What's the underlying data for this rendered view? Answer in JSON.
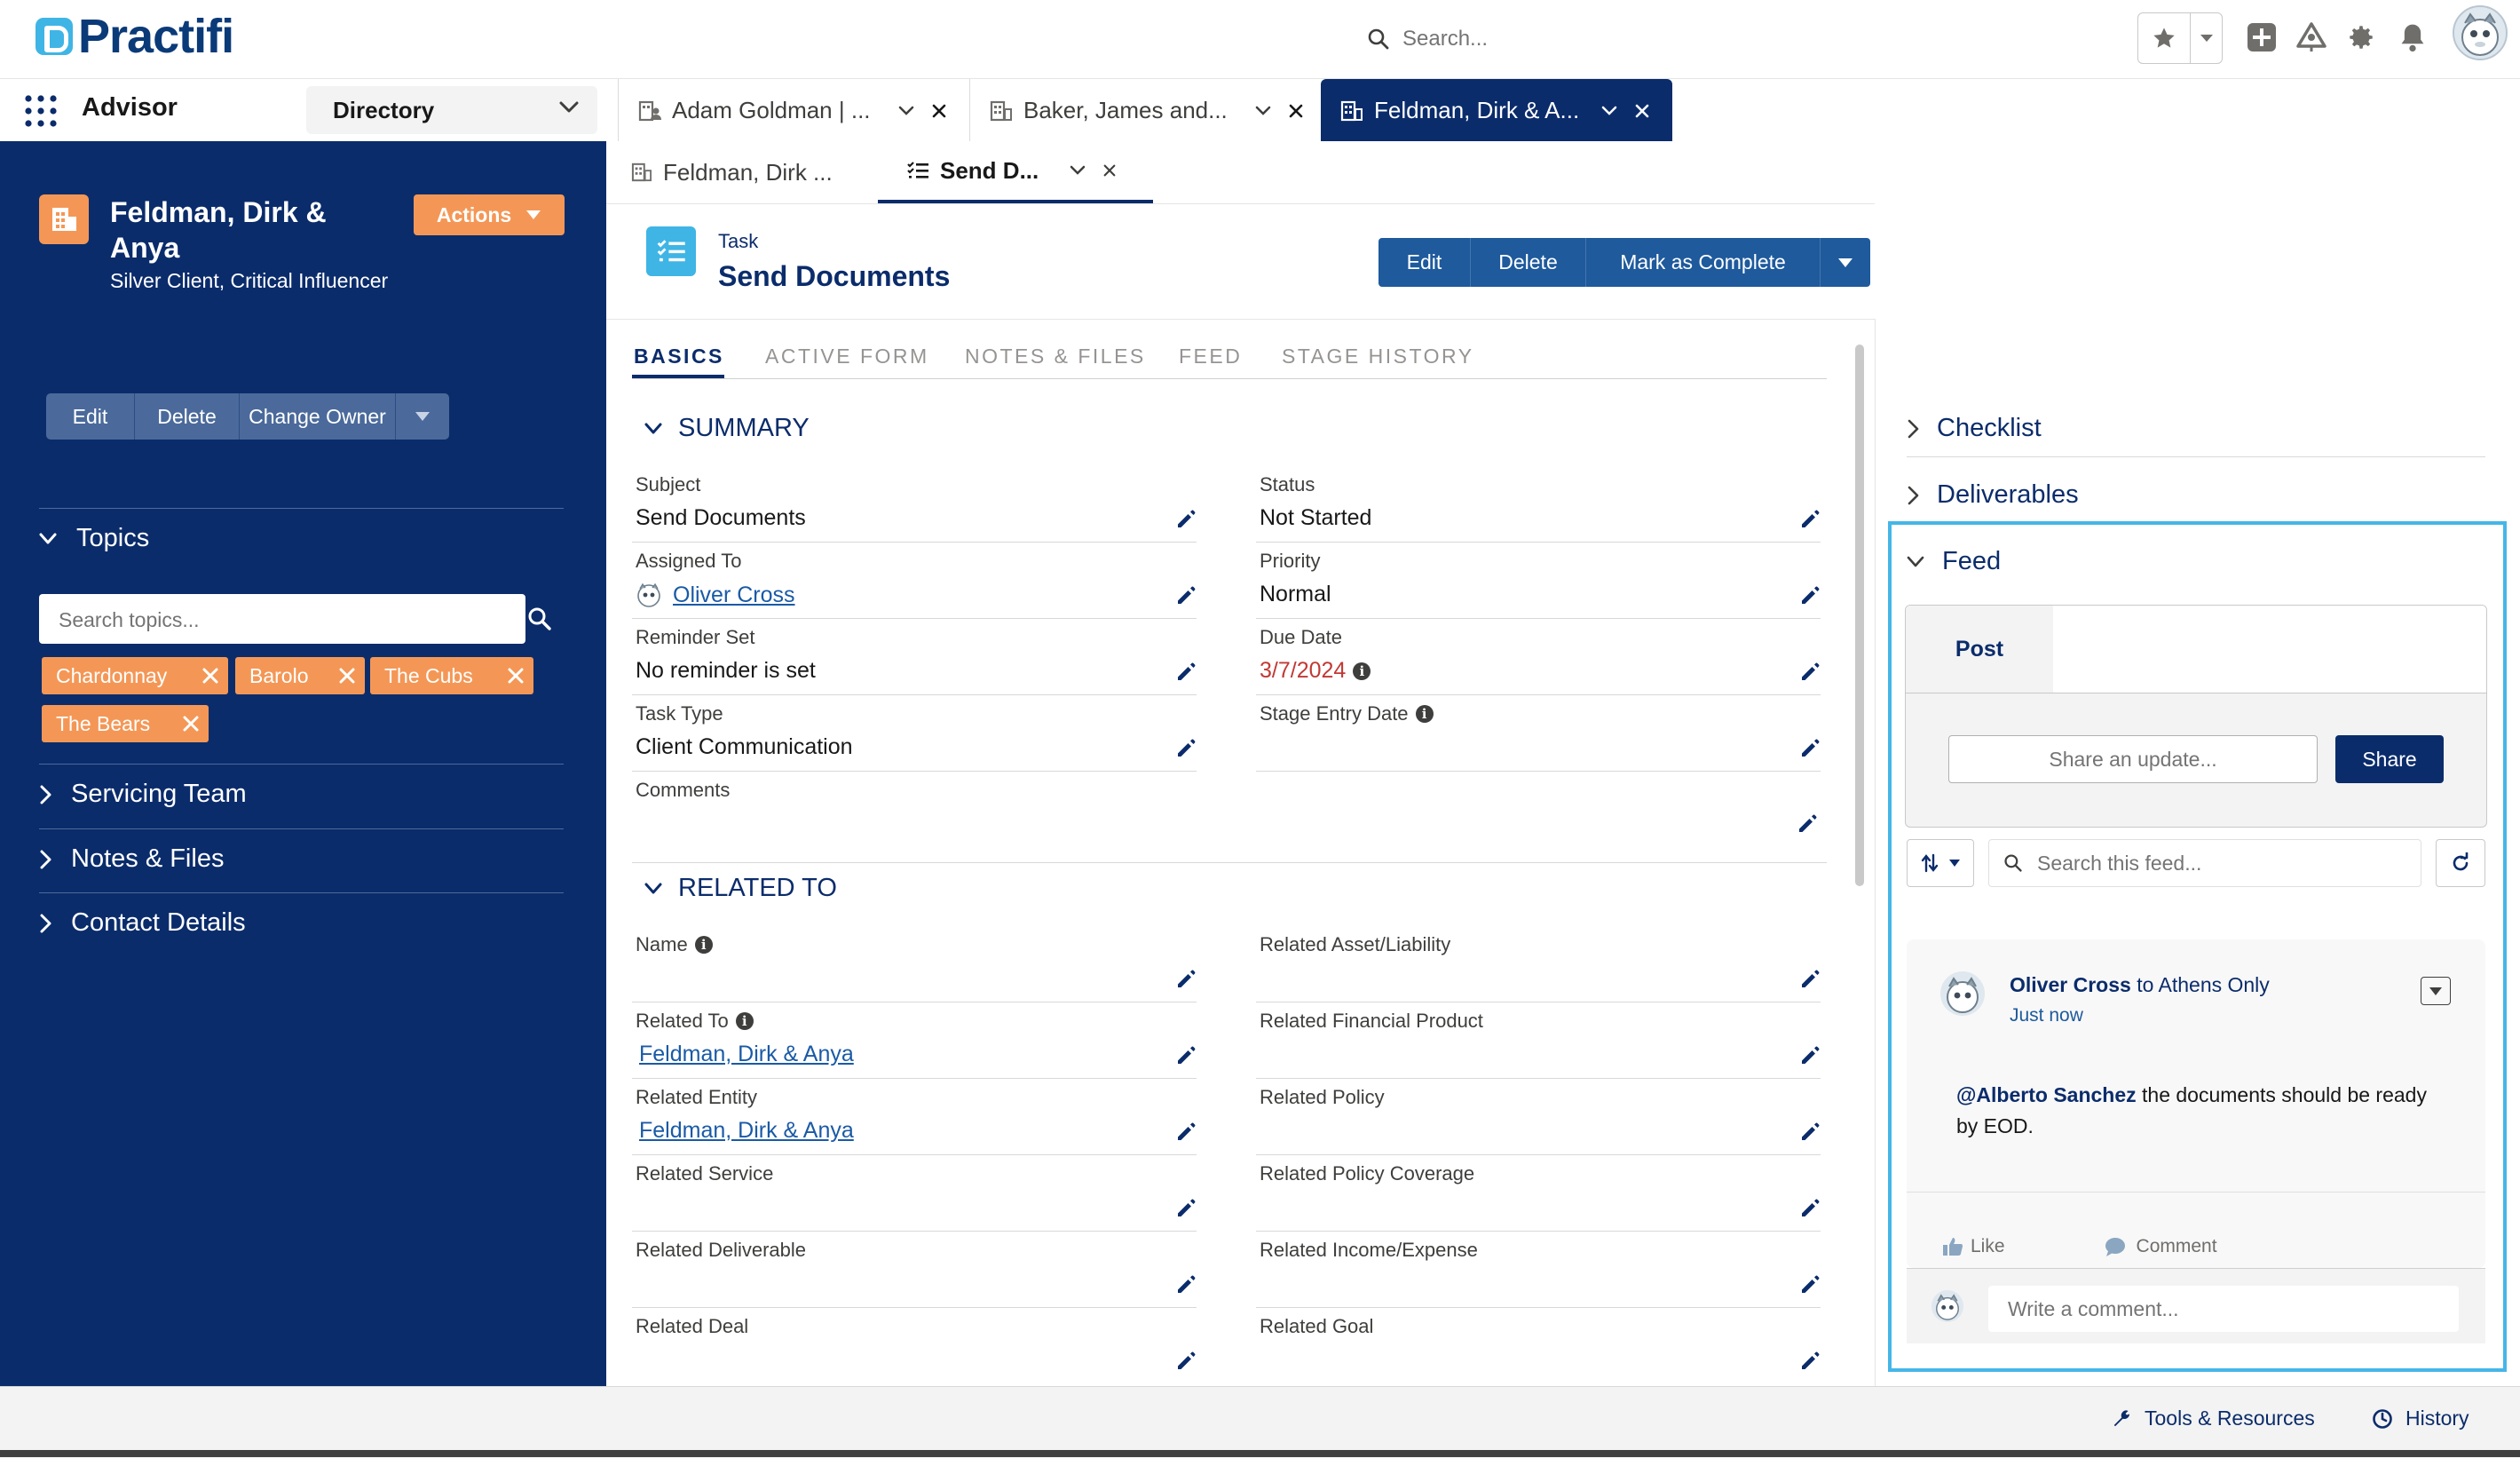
{
  "brand": {
    "name": "Practifi"
  },
  "global_header": {
    "search_placeholder": "Search..."
  },
  "nav": {
    "app_name": "Advisor",
    "directory_label": "Directory",
    "workspace_tabs": [
      {
        "label": "Adam Goldman | ..."
      },
      {
        "label": "Baker, James and..."
      },
      {
        "label": "Feldman, Dirk & A..."
      }
    ]
  },
  "sub_tabs": [
    {
      "label": "Feldman, Dirk ..."
    },
    {
      "label": "Send D..."
    }
  ],
  "left_panel": {
    "record_name": "Feldman, Dirk & Anya",
    "record_subtitle": "Silver Client, Critical Influencer",
    "actions_label": "Actions",
    "buttons": [
      "Edit",
      "Delete",
      "Change Owner"
    ],
    "topics_label": "Topics",
    "topic_search_placeholder": "Search topics...",
    "topics": [
      "Chardonnay",
      "Barolo",
      "The Cubs",
      "The Bears"
    ],
    "sections": [
      "Servicing Team",
      "Notes & Files",
      "Contact Details"
    ]
  },
  "record": {
    "type": "Task",
    "title": "Send Documents",
    "buttons": [
      "Edit",
      "Delete",
      "Mark as Complete"
    ]
  },
  "section_tabs": [
    "BASICS",
    "ACTIVE FORM",
    "NOTES & FILES",
    "FEED",
    "STAGE HISTORY"
  ],
  "summary": {
    "heading": "SUMMARY",
    "left_fields": [
      {
        "label": "Subject",
        "value": "Send Documents"
      },
      {
        "label": "Assigned To",
        "value": "Oliver Cross"
      },
      {
        "label": "Reminder Set",
        "value": "No reminder is set"
      },
      {
        "label": "Task Type",
        "value": "Client Communication"
      },
      {
        "label": "Comments",
        "value": ""
      }
    ],
    "right_fields": [
      {
        "label": "Status",
        "value": "Not Started"
      },
      {
        "label": "Priority",
        "value": "Normal"
      },
      {
        "label": "Due Date",
        "value": "3/7/2024"
      },
      {
        "label": "Stage Entry Date",
        "value": ""
      }
    ]
  },
  "related": {
    "heading": "RELATED TO",
    "left_fields": [
      {
        "label": "Name",
        "value": ""
      },
      {
        "label": "Related To",
        "value": "Feldman, Dirk & Anya"
      },
      {
        "label": "Related Entity",
        "value": "Feldman, Dirk & Anya"
      },
      {
        "label": "Related Service",
        "value": ""
      },
      {
        "label": "Related Deliverable",
        "value": ""
      },
      {
        "label": "Related Deal",
        "value": ""
      }
    ],
    "right_fields": [
      {
        "label": "Related Asset/Liability",
        "value": ""
      },
      {
        "label": "Related Financial Product",
        "value": ""
      },
      {
        "label": "Related Policy",
        "value": ""
      },
      {
        "label": "Related Policy Coverage",
        "value": ""
      },
      {
        "label": "Related Income/Expense",
        "value": ""
      },
      {
        "label": "Related Goal",
        "value": ""
      }
    ]
  },
  "right_panel": {
    "sections": [
      "Checklist",
      "Deliverables",
      "Feed"
    ],
    "post_tab": "Post",
    "share_placeholder": "Share an update...",
    "share_button": "Share",
    "feed_search_placeholder": "Search this feed...",
    "feed_item": {
      "author": "Oliver Cross",
      "to_text": "to",
      "group": "Athens Only",
      "time": "Just now",
      "mention": "@Alberto Sanchez",
      "body": " the documents should be ready by EOD.",
      "like_label": "Like",
      "comment_label": "Comment"
    },
    "comment_placeholder": "Write a comment..."
  },
  "footer": {
    "items": [
      "Tools & Resources",
      "History"
    ]
  },
  "colors": {
    "navy": "#0b2c6b",
    "accent_orange": "#f49756",
    "accent_blue": "#3fb5e5",
    "highlight": "#45b6e8",
    "due_date": "#c23934"
  }
}
